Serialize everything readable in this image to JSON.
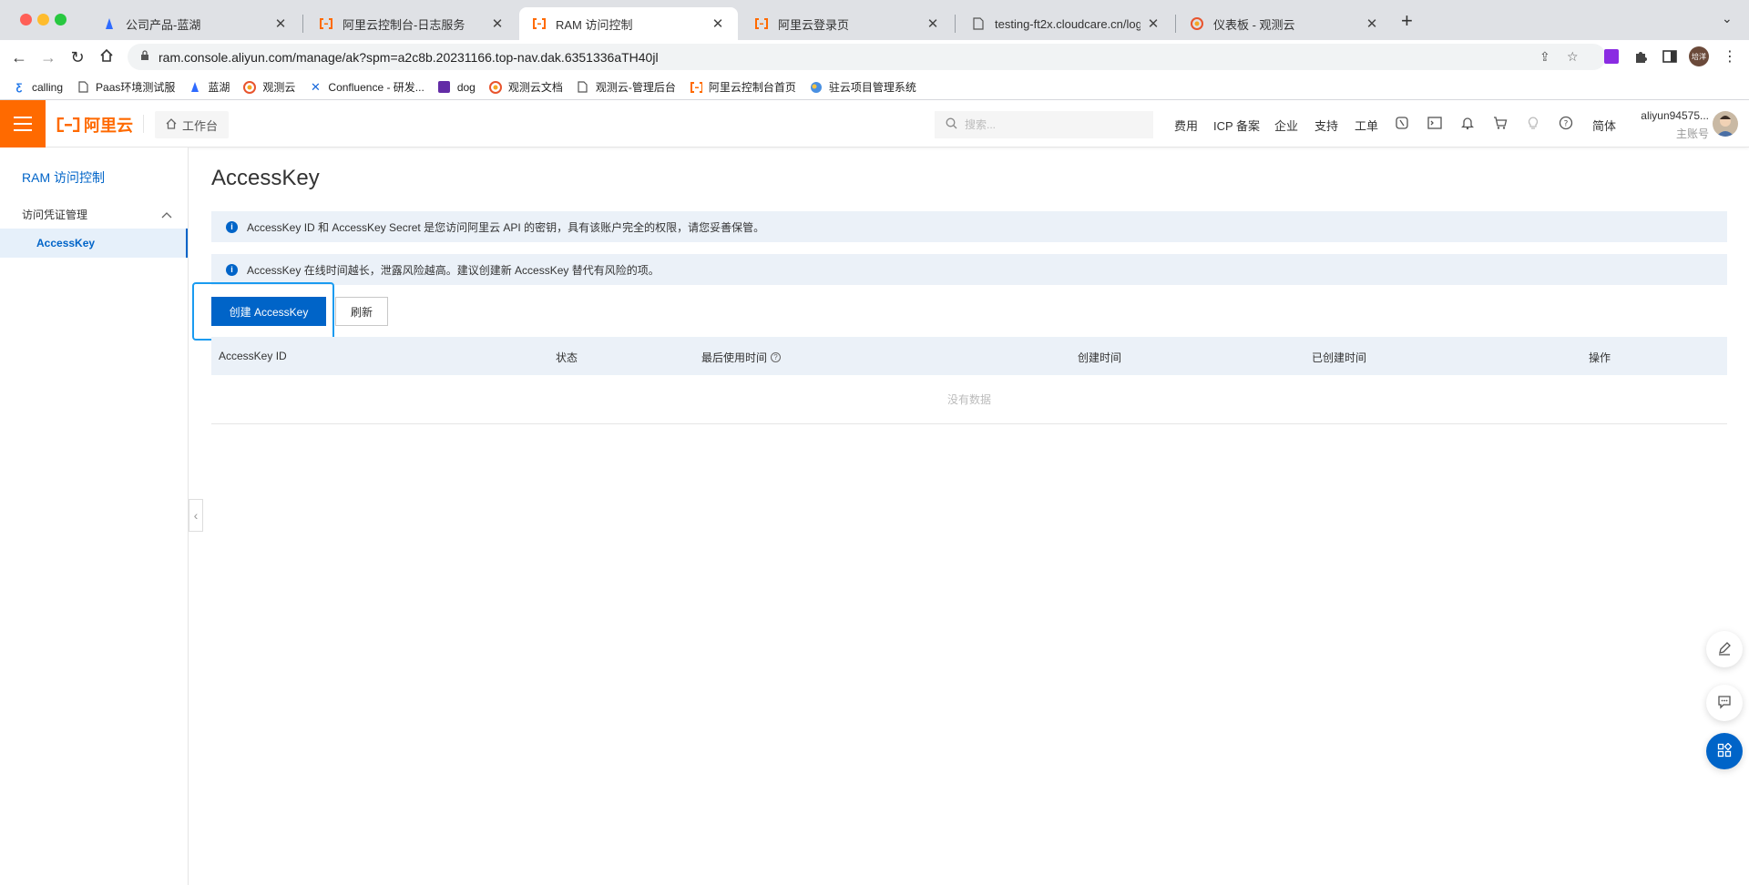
{
  "browser": {
    "tabs": [
      {
        "title": "公司产品-蓝湖"
      },
      {
        "title": "阿里云控制台-日志服务"
      },
      {
        "title": "RAM 访问控制"
      },
      {
        "title": "阿里云登录页"
      },
      {
        "title": "testing-ft2x.cloudcare.cn/login"
      },
      {
        "title": "仪表板 - 观测云"
      }
    ],
    "url": "ram.console.aliyun.com/manage/ak?spm=a2c8b.20231166.top-nav.dak.6351336aTH40jl",
    "profile_initials": "培洋",
    "bookmarks": [
      {
        "label": "calling"
      },
      {
        "label": "Paas环境测试服"
      },
      {
        "label": "蓝湖"
      },
      {
        "label": "观测云"
      },
      {
        "label": "Confluence - 研发..."
      },
      {
        "label": "dog"
      },
      {
        "label": "观测云文档"
      },
      {
        "label": "观测云-管理后台"
      },
      {
        "label": "阿里云控制台首页"
      },
      {
        "label": "驻云项目管理系统"
      }
    ]
  },
  "console": {
    "logo_text": "阿里云",
    "workbench_label": "工作台",
    "search_placeholder": "搜索...",
    "links": {
      "fee": "费用",
      "icp": "ICP 备案",
      "enterprise": "企业",
      "support": "支持",
      "ticket": "工单",
      "lang": "简体"
    },
    "user": {
      "name": "aliyun94575...",
      "role": "主账号"
    }
  },
  "sidebar": {
    "title": "RAM 访问控制",
    "group_label": "访问凭证管理",
    "items": [
      {
        "label": "AccessKey"
      }
    ]
  },
  "main": {
    "title": "AccessKey",
    "notices": [
      "AccessKey ID 和 AccessKey Secret 是您访问阿里云 API 的密钥，具有该账户完全的权限，请您妥善保管。",
      "AccessKey 在线时间越长，泄露风险越高。建议创建新 AccessKey 替代有风险的项。"
    ],
    "create_button": "创建 AccessKey",
    "refresh_button": "刷新",
    "table": {
      "columns": [
        "AccessKey ID",
        "状态",
        "最后使用时间",
        "创建时间",
        "已创建时间",
        "操作"
      ],
      "empty_text": "没有数据"
    }
  },
  "colors": {
    "brand_orange": "#ff6a00",
    "primary_blue": "#0064c8",
    "highlight_border": "#1a9bf0"
  }
}
